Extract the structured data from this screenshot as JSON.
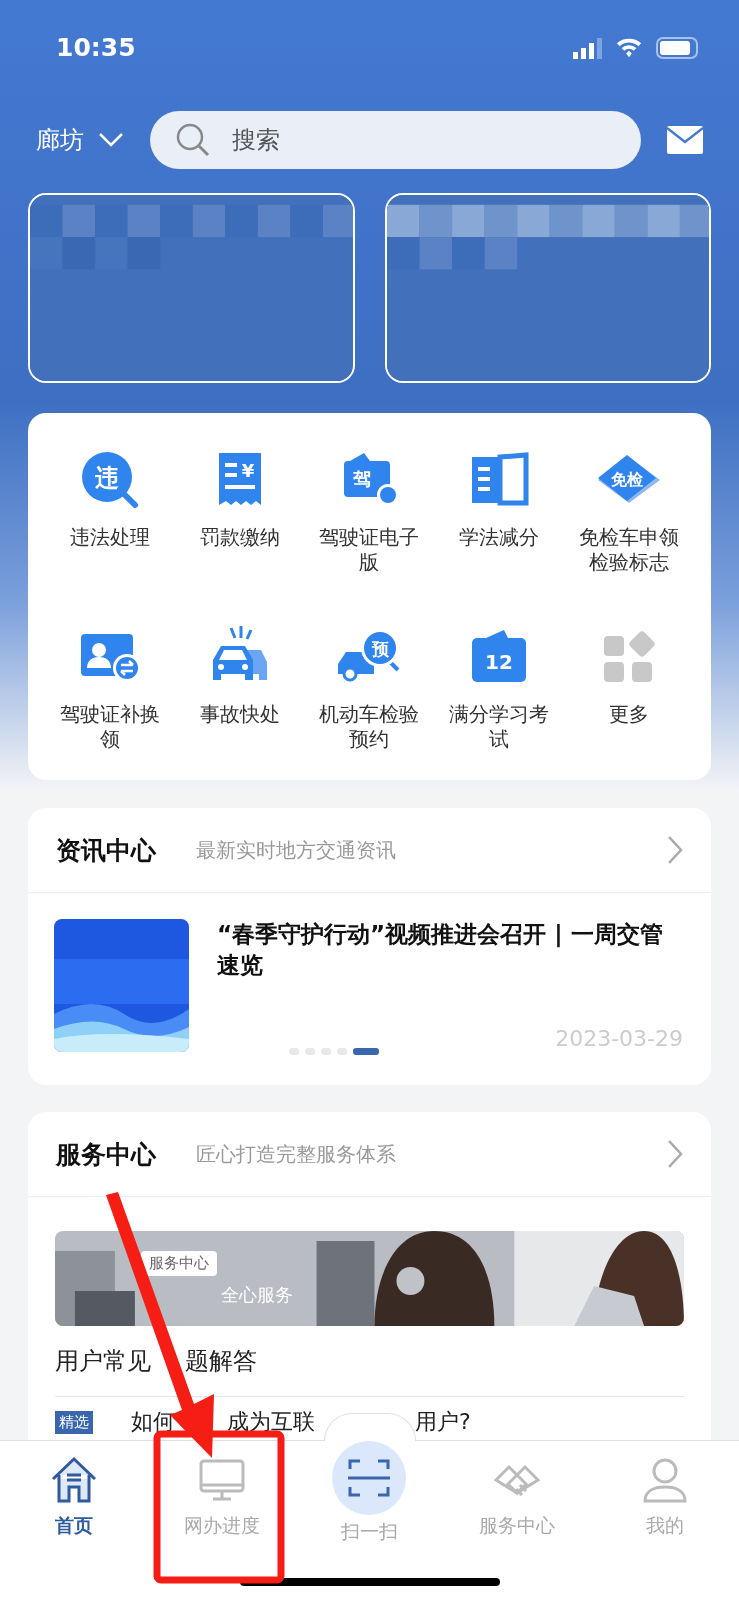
{
  "status_bar": {
    "time": "10:35"
  },
  "header": {
    "city": "廊坊",
    "search": {
      "placeholder": "搜索"
    }
  },
  "services": [
    {
      "kind": "magnifier",
      "icon_text": "违",
      "label": "违法处理"
    },
    {
      "kind": "receipt",
      "icon_text": "¥",
      "label": "罚款缴纳"
    },
    {
      "kind": "license",
      "icon_text": "驾",
      "label": "驾驶证电子版"
    },
    {
      "kind": "book",
      "label": "学法减分"
    },
    {
      "kind": "diamond",
      "icon_text": "免检",
      "label": "免检车申领检验标志"
    },
    {
      "kind": "card-swap",
      "label": "驾驶证补换领"
    },
    {
      "kind": "crash",
      "label": "事故快处"
    },
    {
      "kind": "car-booking",
      "icon_text": "预",
      "label": "机动车检验预约"
    },
    {
      "kind": "calendar",
      "icon_text": "12",
      "label": "满分学习考试"
    },
    {
      "kind": "grid",
      "label": "更多"
    }
  ],
  "news": {
    "title": "资讯中心",
    "subtitle": "最新实时地方交通资讯",
    "article": {
      "title": "“春季守护行动”视频推进会召开 | 一周交管速览",
      "date": "2023-03-29"
    },
    "pages": [
      {
        "selected": false
      },
      {
        "selected": false
      },
      {
        "selected": false
      },
      {
        "selected": false
      },
      {
        "selected": true
      }
    ]
  },
  "service_center": {
    "title": "服务中心",
    "subtitle": "匠心打造完整服务体系",
    "banner": {
      "tag": "服务中心",
      "caption": "全心服务"
    },
    "faq_parts": [
      "用户常见",
      "题解答"
    ],
    "article": {
      "tag": "精选",
      "title_parts": [
        "如何",
        "成为互联",
        "用户?"
      ]
    }
  },
  "tabs": [
    {
      "kind": "home",
      "label": "首页",
      "selected": true
    },
    {
      "kind": "monitor",
      "label": "网办进度",
      "selected": false
    },
    {
      "kind": "scan",
      "label": "扫一扫",
      "selected": false
    },
    {
      "kind": "handshake",
      "label": "服务中心",
      "selected": false
    },
    {
      "kind": "person",
      "label": "我的",
      "selected": false
    }
  ]
}
